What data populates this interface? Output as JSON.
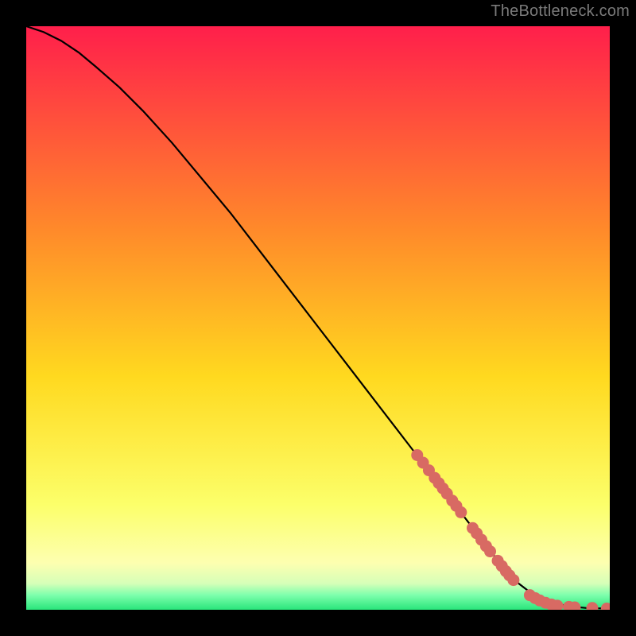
{
  "watermark": "TheBottleneck.com",
  "colors": {
    "grad_top": "#ff1f4b",
    "grad_mid_upper": "#ff8a2a",
    "grad_mid": "#ffd91f",
    "grad_lower": "#fcff6a",
    "grad_green_light": "#b9ffad",
    "grad_green": "#29e57b",
    "curve": "#000000",
    "marker": "#d86a63",
    "bg": "#000000"
  },
  "chart_data": {
    "type": "line",
    "title": "",
    "xlabel": "",
    "ylabel": "",
    "xlim": [
      0,
      100
    ],
    "ylim": [
      0,
      100
    ],
    "curve": {
      "x": [
        0,
        3,
        6,
        9,
        12,
        16,
        20,
        25,
        30,
        35,
        40,
        45,
        50,
        55,
        60,
        65,
        70,
        75,
        80,
        82,
        84,
        87,
        90,
        93,
        96,
        100
      ],
      "y": [
        100,
        99,
        97.5,
        95.5,
        93,
        89.5,
        85.5,
        80,
        74,
        68,
        61.5,
        55,
        48.5,
        42,
        35.5,
        29,
        22.5,
        16,
        9.5,
        7,
        4.8,
        2.5,
        1.2,
        0.6,
        0.3,
        0.2
      ]
    },
    "markers": {
      "upper_cluster": [
        {
          "x": 67,
          "y": 26.5
        },
        {
          "x": 68,
          "y": 25.2
        },
        {
          "x": 69,
          "y": 23.9
        },
        {
          "x": 70,
          "y": 22.6
        },
        {
          "x": 70.7,
          "y": 21.7
        },
        {
          "x": 71.4,
          "y": 20.8
        },
        {
          "x": 72.1,
          "y": 19.9
        },
        {
          "x": 73,
          "y": 18.7
        },
        {
          "x": 73.7,
          "y": 17.8
        },
        {
          "x": 74.5,
          "y": 16.7
        }
      ],
      "mid_cluster": [
        {
          "x": 76.5,
          "y": 14.0
        },
        {
          "x": 77.2,
          "y": 13.1
        },
        {
          "x": 78.0,
          "y": 12.0
        },
        {
          "x": 78.8,
          "y": 10.9
        },
        {
          "x": 79.5,
          "y": 10.0
        }
      ],
      "low_cluster": [
        {
          "x": 80.8,
          "y": 8.4
        },
        {
          "x": 81.5,
          "y": 7.5
        },
        {
          "x": 82.2,
          "y": 6.6
        },
        {
          "x": 82.8,
          "y": 5.9
        },
        {
          "x": 83.5,
          "y": 5.1
        }
      ],
      "tail": [
        {
          "x": 86.3,
          "y": 2.5
        },
        {
          "x": 87.2,
          "y": 2.0
        },
        {
          "x": 88.0,
          "y": 1.6
        },
        {
          "x": 89.0,
          "y": 1.2
        },
        {
          "x": 90.0,
          "y": 0.9
        },
        {
          "x": 91.0,
          "y": 0.7
        },
        {
          "x": 93.0,
          "y": 0.5
        },
        {
          "x": 94.0,
          "y": 0.4
        },
        {
          "x": 97.0,
          "y": 0.3
        },
        {
          "x": 99.5,
          "y": 0.2
        }
      ]
    }
  }
}
